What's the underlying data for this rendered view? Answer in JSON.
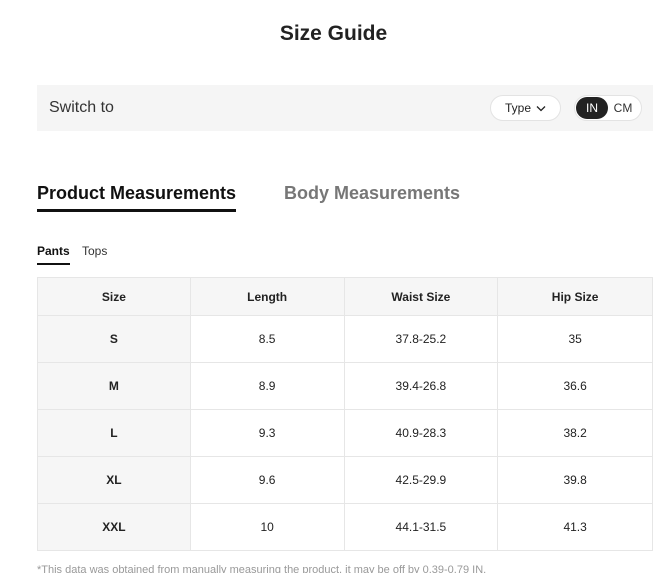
{
  "title": "Size Guide",
  "switch_bar": {
    "label": "Switch to",
    "type_label": "Type",
    "units": {
      "active": "IN",
      "inactive": "CM"
    }
  },
  "main_tabs": [
    "Product Measurements",
    "Body Measurements"
  ],
  "active_main_tab": "Product Measurements",
  "sub_tabs": [
    "Pants",
    "Tops"
  ],
  "active_sub_tab": "Pants",
  "table": {
    "headers": [
      "Size",
      "Length",
      "Waist Size",
      "Hip Size"
    ],
    "rows": [
      [
        "S",
        "8.5",
        "37.8-25.2",
        "35"
      ],
      [
        "M",
        "8.9",
        "39.4-26.8",
        "36.6"
      ],
      [
        "L",
        "9.3",
        "40.9-28.3",
        "38.2"
      ],
      [
        "XL",
        "9.6",
        "42.5-29.9",
        "39.8"
      ],
      [
        "XXL",
        "10",
        "44.1-31.5",
        "41.3"
      ]
    ]
  },
  "note": "*This data was obtained from manually measuring the product, it may be off by 0.39-0.79 IN."
}
